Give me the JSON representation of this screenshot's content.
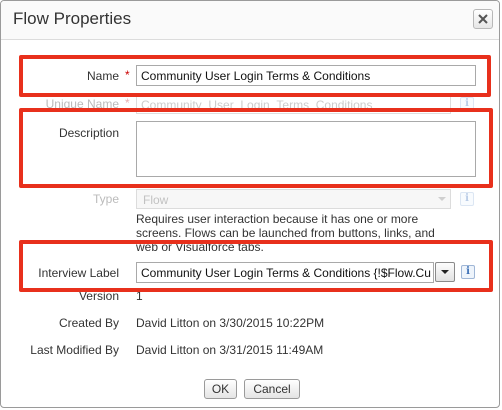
{
  "dialog": {
    "title": "Flow Properties"
  },
  "fields": {
    "name": {
      "label": "Name",
      "required_mark": "*",
      "value": "Community User Login Terms & Conditions"
    },
    "unique_name": {
      "label": "Unique Name",
      "required_mark": "*",
      "value": "Community_User_Login_Terms_Conditions"
    },
    "description": {
      "label": "Description",
      "value": ""
    },
    "type": {
      "label": "Type",
      "selected": "Flow",
      "hint": "Requires user interaction because it has one or more screens. Flows can be launched from buttons, links, and web or Visualforce tabs."
    },
    "interview_label": {
      "label": "Interview Label",
      "value": "Community User Login Terms & Conditions {!$Flow.Cu"
    },
    "version": {
      "label": "Version",
      "value": "1"
    },
    "created_by": {
      "label": "Created By",
      "value": "David Litton on 3/30/2015 10:22PM"
    },
    "last_modified_by": {
      "label": "Last Modified By",
      "value": "David Litton on 3/31/2015 11:49AM"
    }
  },
  "buttons": {
    "ok": "OK",
    "cancel": "Cancel"
  },
  "icons": {
    "info": "i",
    "close": "close-icon",
    "dropdown": "chevron-down-icon"
  },
  "colors": {
    "highlight": "#e8301c",
    "required": "#cc0000",
    "info_icon": "#3a6fb6"
  }
}
